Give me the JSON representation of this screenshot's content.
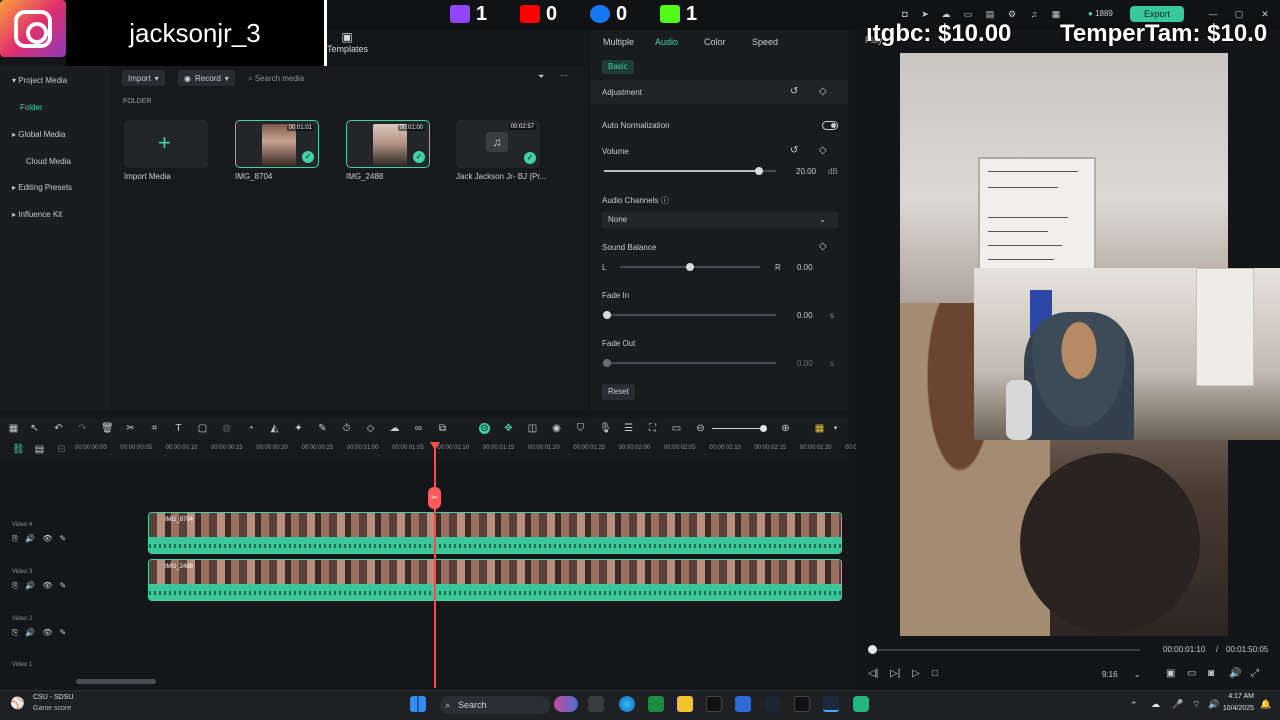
{
  "overlay": {
    "username": "jacksonjr_3",
    "stats": [
      {
        "icon": "twitch-icon",
        "value": "1",
        "color": "#9146ff"
      },
      {
        "icon": "youtube-icon",
        "value": "0",
        "color": "#ff0000"
      },
      {
        "icon": "facebook-icon",
        "value": "0",
        "color": "#1877f2"
      },
      {
        "icon": "kick-icon",
        "value": "1",
        "color": "#53fc18"
      }
    ],
    "donation_left": "ıtgbc: $10.00",
    "donation_right": "TemperTam: $10.0"
  },
  "app": {
    "templates_label": "Templates",
    "coins": "1889",
    "export_label": "Export",
    "play_label": "Play"
  },
  "left_nav": {
    "items": [
      "Project Media",
      "Folder",
      "Global Media",
      "Cloud Media",
      "Editing Presets",
      "Influence Kit"
    ]
  },
  "media": {
    "import_label": "Import",
    "record_label": "Record",
    "search_placeholder": "Search media",
    "folder_label": "FOLDER",
    "tiles": [
      {
        "name": "Import Media",
        "duration": ""
      },
      {
        "name": "IMG_8704",
        "duration": "00:01:01"
      },
      {
        "name": "IMG_2488",
        "duration": "00:01:00"
      },
      {
        "name": "Jack Jackson Jr- BJ (Pr...",
        "duration": "00:02:57"
      }
    ]
  },
  "props": {
    "tabs": [
      "Multiple",
      "Audio",
      "Color",
      "Speed"
    ],
    "active_tab": "Audio",
    "basic_label": "Basic",
    "adjustment": "Adjustment",
    "auto_normalization": "Auto Normalization",
    "volume": "Volume",
    "volume_value": "20.00",
    "volume_unit": "dB",
    "volume_level": 0.9,
    "audio_channels": "Audio Channels",
    "channel_value": "None",
    "sound_balance": "Sound Balance",
    "balance_left": "L",
    "balance_right": "R",
    "balance_value": "0.00",
    "fade_in": "Fade In",
    "fade_in_value": "0.00",
    "fade_out": "Fade Out",
    "fade_out_value": "0.00",
    "seconds_unit": "s",
    "reset_label": "Reset"
  },
  "timeline": {
    "ticks": [
      "00:00:00:00",
      "00:00:00:05",
      "00:00:00:10",
      "00:00:00:15",
      "00:00:00:20",
      "00:00:00:25",
      "00:00:01:00",
      "00:00:01:05",
      "00:00:01:10",
      "00:00:01:15",
      "00:00:01:20",
      "00:00:01:25",
      "00:00:02:00",
      "00:00:02:05",
      "00:00:02:10",
      "00:00:02:15",
      "00:00:02:20",
      "00:00:02:25"
    ],
    "tracks": [
      {
        "name": "Video 4",
        "clip": "IMG_8704"
      },
      {
        "name": "Video 3",
        "clip": "IMG_2488"
      },
      {
        "name": "Video 2",
        "clip": ""
      },
      {
        "name": "Video 1",
        "clip": ""
      }
    ]
  },
  "preview": {
    "current_time": "00:00:01:10",
    "separator": "/",
    "total_time": "00:01:50:05",
    "ratio": "9:16"
  },
  "taskbar": {
    "game_title": "CSU - SDSU",
    "game_sub": "Game score",
    "search_label": "Search",
    "time": "4:17 AM",
    "date": "10/4/2025"
  }
}
